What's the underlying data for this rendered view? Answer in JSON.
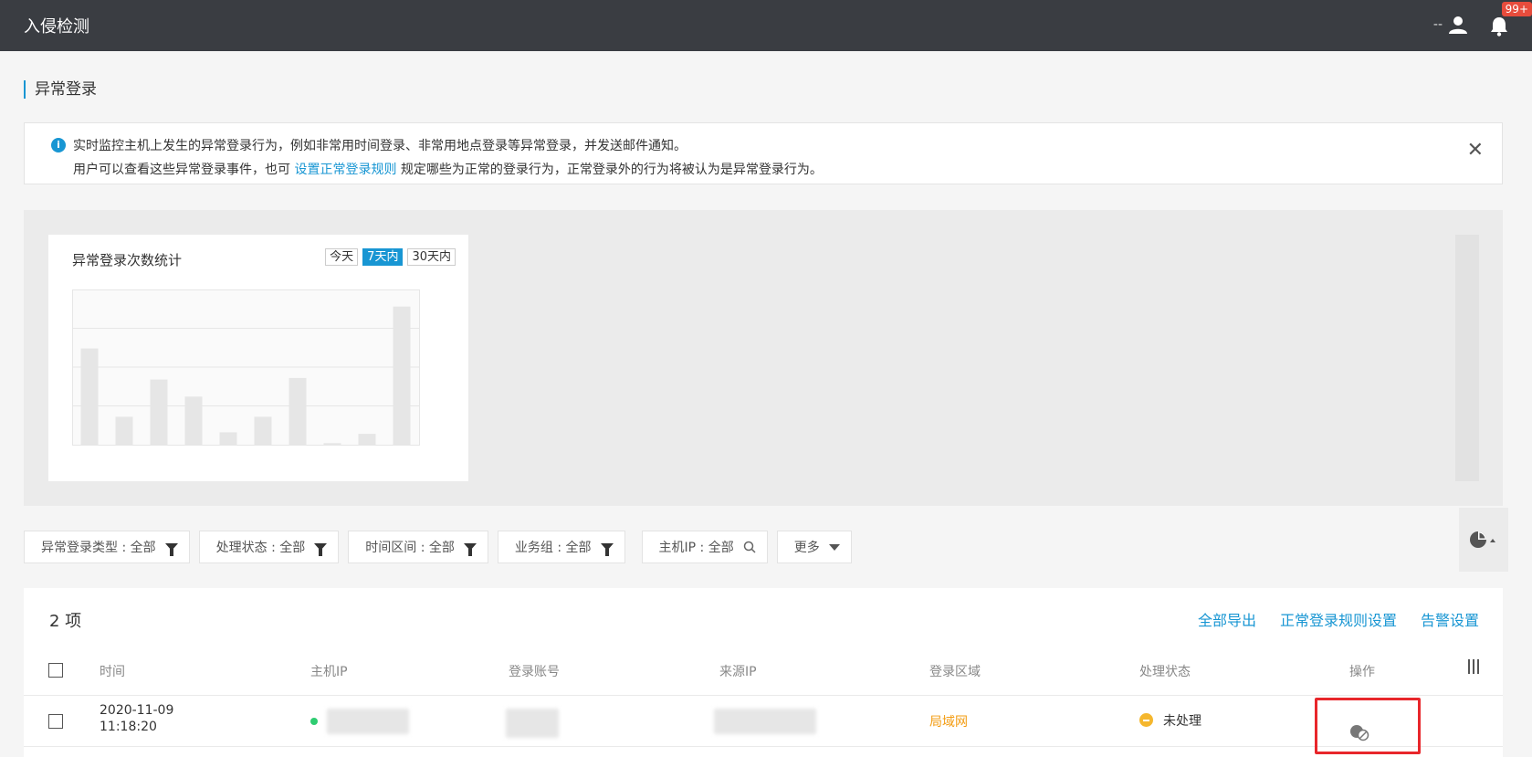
{
  "header": {
    "title": "入侵检测",
    "user_label": "--",
    "notification_count": "99+"
  },
  "page": {
    "title": "异常登录"
  },
  "info": {
    "line1": "实时监控主机上发生的异常登录行为，例如非常用时间登录、非常用地点登录等异常登录，并发送邮件通知。",
    "line2_before": "用户可以查看这些异常登录事件，也可",
    "line2_link": "设置正常登录规则",
    "line2_after": "规定哪些为正常的登录行为，正常登录外的行为将被认为是异常登录行为。"
  },
  "chart": {
    "ranges": [
      {
        "label": "今天",
        "active": false
      },
      {
        "label": "7天内",
        "active": true
      },
      {
        "label": "30天内",
        "active": false
      }
    ]
  },
  "chart_data": {
    "type": "bar",
    "title": "异常登录次数统计",
    "values": [
      62,
      18,
      42,
      31,
      8,
      18,
      43,
      1,
      7,
      89
    ],
    "ylim": [
      0,
      100
    ],
    "grid": true
  },
  "filters": [
    {
      "label": "异常登录类型 : 全部",
      "icon": "funnel-icon"
    },
    {
      "label": "处理状态 : 全部",
      "icon": "funnel-icon"
    },
    {
      "label": "时间区间 : 全部",
      "icon": "funnel-icon"
    },
    {
      "label": "业务组 : 全部",
      "icon": "funnel-icon"
    },
    {
      "label": "主机IP : 全部",
      "icon": "search-icon"
    },
    {
      "label": "更多",
      "icon": "caret-down-icon"
    }
  ],
  "table": {
    "count_label": "2 项",
    "actions": {
      "export_all": "全部导出",
      "rule_settings": "正常登录规则设置",
      "alert_settings": "告警设置"
    },
    "columns": {
      "time": "时间",
      "host_ip": "主机IP",
      "account": "登录账号",
      "source_ip": "来源IP",
      "region": "登录区域",
      "status": "处理状态",
      "operation": "操作"
    },
    "rows": [
      {
        "date": "2020-11-09",
        "time": "11:18:20",
        "region": "局域网",
        "status": "未处理"
      }
    ]
  }
}
